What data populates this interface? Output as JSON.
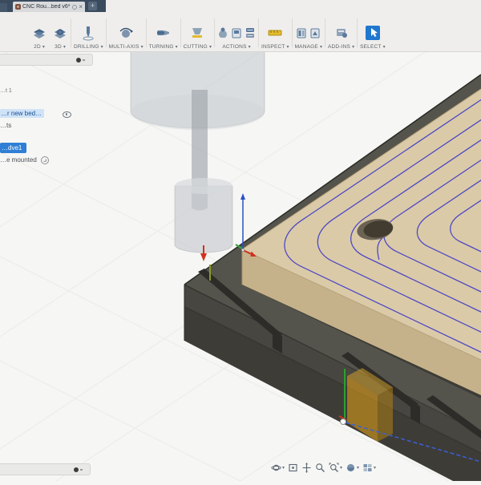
{
  "ui": {
    "caret": "▾"
  },
  "titlebar": {
    "tab_title": "CNC Rou...bed v6*",
    "close_label": "×",
    "new_tab_label": "+"
  },
  "toolbar": {
    "groups": [
      {
        "label": "2D"
      },
      {
        "label": "3D"
      },
      {
        "label": "DRILLING"
      },
      {
        "label": "MULTI-AXIS"
      },
      {
        "label": "TURNING"
      },
      {
        "label": "CUTTING"
      },
      {
        "label": "ACTIONS"
      },
      {
        "label": "INSPECT"
      },
      {
        "label": "MANAGE"
      },
      {
        "label": "ADD-INS"
      },
      {
        "label": "SELECT"
      }
    ]
  },
  "browser": {
    "item_top": "…t 1",
    "selected_document": "…r new bed…",
    "item_children": "…ts",
    "active_operation": "…dve1",
    "annotation": "…e mounted"
  },
  "navbar": {
    "items": [
      "orbit",
      "look-at",
      "pan",
      "zoom",
      "fit",
      "display-settings",
      "viewports"
    ]
  },
  "colors": {
    "accent_blue": "#1f77d0",
    "selection_highlight": "#cfe3f8",
    "toolpath_blue": "#4d49c5",
    "mdf_top": "#dbcaa8",
    "bed_dark": "#3d3c37",
    "stock_highlight": "#e8a416",
    "tabbar_dark": "#3a4b5e"
  }
}
